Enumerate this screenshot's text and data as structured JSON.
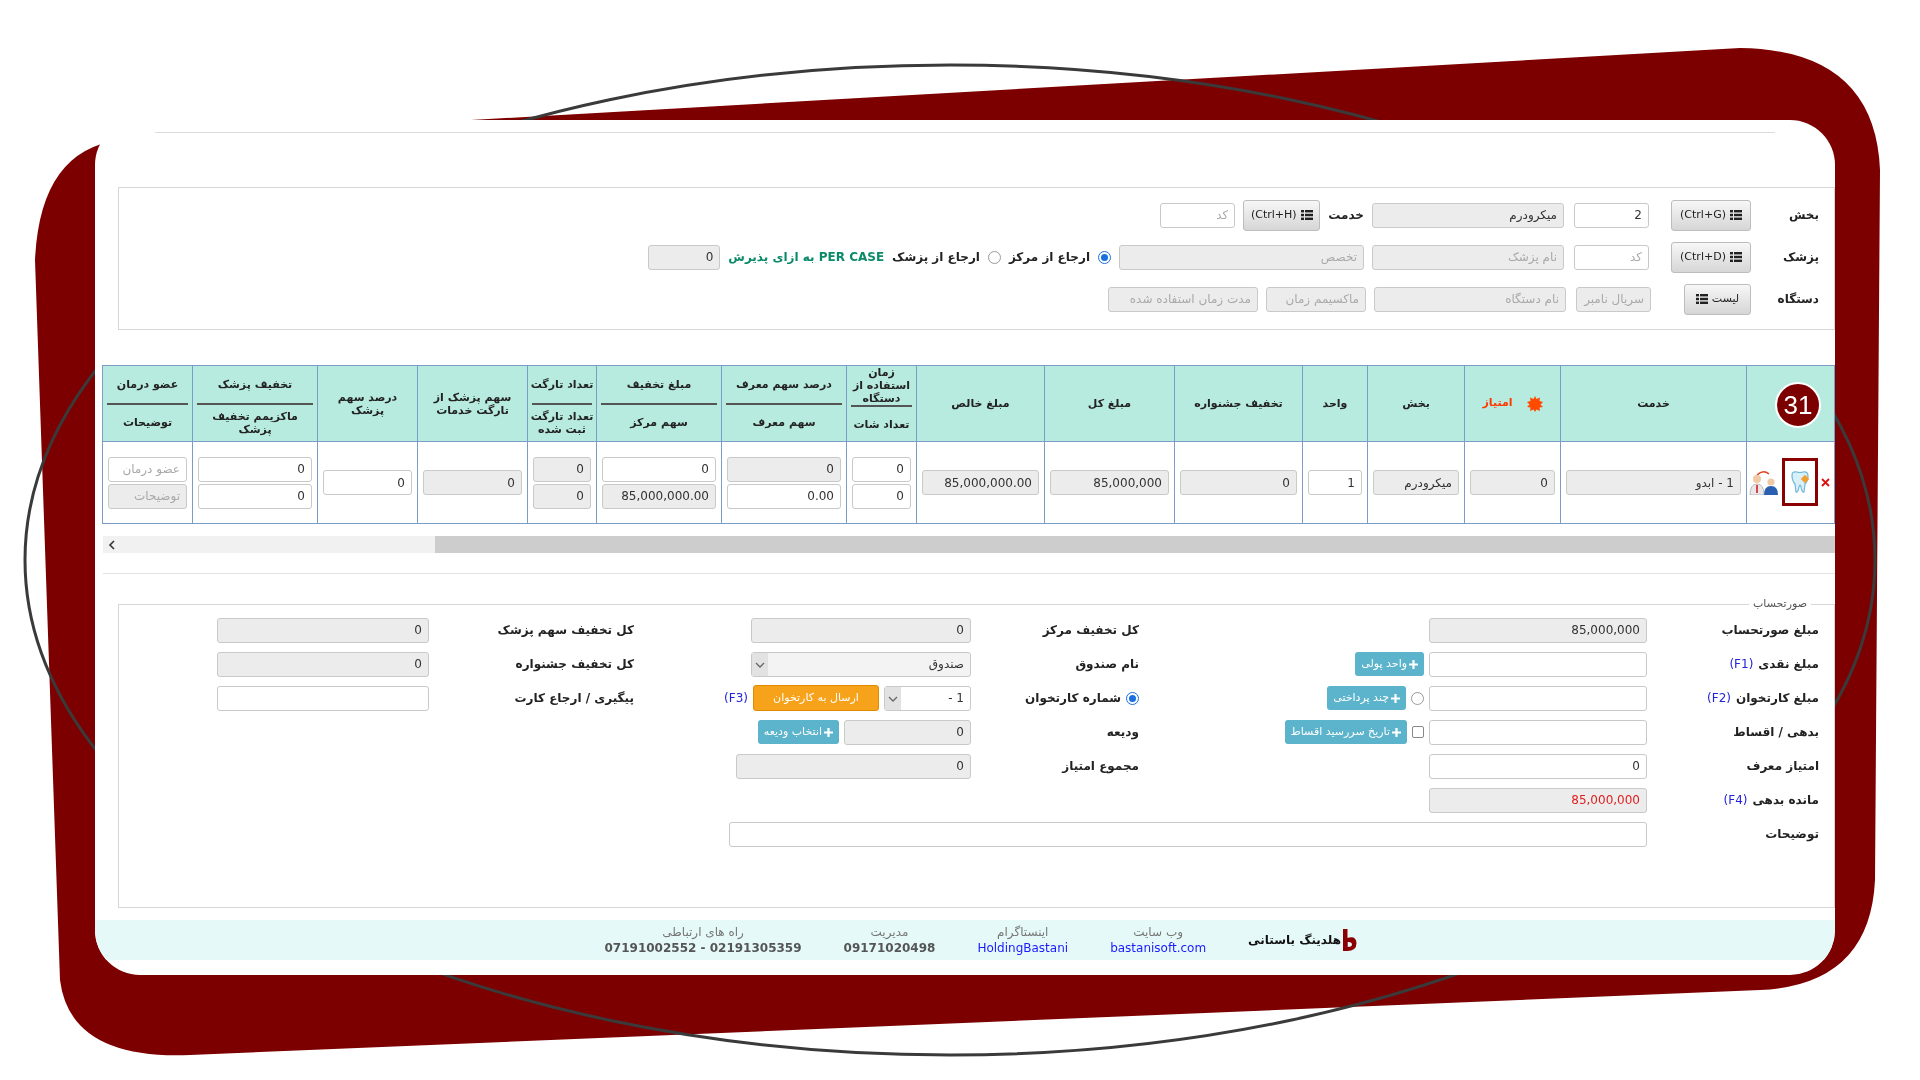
{
  "top_form": {
    "section": {
      "label": "بخش",
      "button": "(Ctrl+G)",
      "code": {
        "value": "2",
        "readonly": false
      },
      "name": {
        "value": "میکرودرم",
        "readonly": true
      }
    },
    "service": {
      "label": "خدمت",
      "button": "(Ctrl+H)",
      "code": {
        "placeholder": "کد",
        "readonly": false
      }
    },
    "doctor": {
      "label": "پزشک",
      "button": "(Ctrl+D)",
      "code": {
        "placeholder": "کد",
        "readonly": false
      },
      "name": {
        "placeholder": "نام پزشک",
        "readonly": true
      },
      "specialty": {
        "placeholder": "تخصص",
        "readonly": true
      }
    },
    "referral": [
      {
        "label": "ارجاع از مرکز",
        "selected": true
      },
      {
        "label": "ارجاع از پزشک",
        "selected": false
      }
    ],
    "per_case": {
      "label": "PER CASE به ازای پذیرش",
      "field": {
        "value": "0",
        "readonly": true
      }
    },
    "device": {
      "label": "دستگاه",
      "button": "لیست",
      "fields": [
        {
          "placeholder": "سریال نامبر",
          "readonly": true
        },
        {
          "placeholder": "نام دستگاه",
          "readonly": true
        },
        {
          "placeholder": "ماکسیمم زمان",
          "readonly": true
        },
        {
          "placeholder": "مدت زمان استفاده شده",
          "readonly": true
        }
      ]
    }
  },
  "table": {
    "columns": [
      {
        "kind": "actions"
      },
      {
        "kind": "text",
        "label": "خدمت",
        "cells": [
          {
            "value": "1 - ابدو",
            "readonly": true
          }
        ]
      },
      {
        "kind": "score",
        "label": "امتیاز",
        "cells": [
          {
            "value": "0",
            "readonly": true
          }
        ]
      },
      {
        "kind": "text",
        "label": "بخش",
        "cells": [
          {
            "value": "میکرودرم",
            "readonly": true
          }
        ]
      },
      {
        "kind": "text",
        "label": "واحد",
        "cells": [
          {
            "value": "1",
            "readonly": false
          }
        ]
      },
      {
        "kind": "text",
        "label": "تخفیف جشنواره",
        "cells": [
          {
            "value": "0",
            "readonly": true
          }
        ]
      },
      {
        "kind": "text",
        "label": "مبلغ کل",
        "cells": [
          {
            "value": "85,000,000",
            "readonly": true
          }
        ]
      },
      {
        "kind": "text",
        "label": "مبلغ خالص",
        "cells": [
          {
            "value": "85,000,000.00",
            "readonly": true
          }
        ]
      },
      {
        "kind": "double",
        "top": "زمان استفاده از دستگاه",
        "bottom": "تعداد شات",
        "cells": [
          {
            "value": "0",
            "readonly": false
          },
          {
            "value": "0",
            "readonly": false
          }
        ]
      },
      {
        "kind": "double",
        "top": "درصد سهم معرف",
        "bottom": "سهم معرف",
        "cells": [
          {
            "value": "0",
            "readonly": true
          },
          {
            "value": "0.00",
            "readonly": false
          }
        ]
      },
      {
        "kind": "double",
        "top": "مبلغ تخفیف",
        "bottom": "سهم مرکز",
        "cells": [
          {
            "value": "0",
            "readonly": false
          },
          {
            "value": "85,000,000.00",
            "readonly": true
          }
        ]
      },
      {
        "kind": "double",
        "top": "تعداد تارگت",
        "bottom": "تعداد تارگت ثبت شده",
        "cells": [
          {
            "value": "0",
            "readonly": true
          },
          {
            "value": "0",
            "readonly": true
          }
        ]
      },
      {
        "kind": "text",
        "label": "سهم پزشک از تارگت خدمات",
        "cells": [
          {
            "value": "0",
            "readonly": true
          }
        ]
      },
      {
        "kind": "text",
        "label": "درصد سهم پزشک",
        "cells": [
          {
            "value": "0",
            "readonly": false
          }
        ]
      },
      {
        "kind": "double",
        "top": "تخفیف پزشک",
        "bottom": "ماکزیمم تخفیف پزشک",
        "cells": [
          {
            "value": "0",
            "readonly": false
          },
          {
            "value": "0",
            "readonly": false
          }
        ]
      },
      {
        "kind": "double",
        "top": "عضو درمان",
        "bottom": "توضیحات",
        "cells": [
          {
            "placeholder": "عضو درمان",
            "readonly": false
          },
          {
            "placeholder": "توضیحات",
            "readonly": true
          }
        ]
      }
    ]
  },
  "annotation": {
    "step": "31"
  },
  "invoice": {
    "title": "صورتحساب",
    "rows": [
      {
        "right": {
          "label": "مبلغ صورتحساب",
          "items": [
            {
              "kind": "input",
              "value": "85,000,000",
              "readonly": true
            }
          ]
        },
        "middle": {
          "label": "کل تخفیف مرکز",
          "items": [
            {
              "kind": "input",
              "value": "0",
              "readonly": true
            }
          ]
        },
        "left": {
          "label": "کل تخفیف سهم پزشک",
          "items": [
            {
              "kind": "input",
              "value": "0",
              "readonly": true
            }
          ]
        }
      },
      {
        "right": {
          "label": "مبلغ نقدی",
          "hotkey": "(F1)",
          "items": [
            {
              "kind": "input",
              "readonly": false
            },
            {
              "kind": "button",
              "label": "واحد پولی"
            }
          ]
        },
        "middle": {
          "label": "نام صندوق",
          "items": [
            {
              "kind": "select",
              "value": "صندوق",
              "readonly": true
            }
          ]
        },
        "left": {
          "label": "کل تخفیف جشنواره",
          "items": [
            {
              "kind": "input",
              "value": "0",
              "readonly": true
            }
          ]
        }
      },
      {
        "right": {
          "label": "مبلغ کارتخوان",
          "hotkey": "(F2)",
          "items": [
            {
              "kind": "input",
              "readonly": false
            },
            {
              "kind": "radio",
              "selected": false
            },
            {
              "kind": "button",
              "label": "چند پرداختی"
            }
          ]
        },
        "middle": {
          "label_radio": {
            "selected": true
          },
          "label": "شماره کارتخوان",
          "items": [
            {
              "kind": "select",
              "value": "1 -",
              "readonly": false
            },
            {
              "kind": "send_button",
              "label": "ارسال به کارتخوان"
            },
            {
              "kind": "hotkey",
              "text": "(F3)"
            }
          ]
        },
        "left": {
          "label": "پیگیری / ارجاع کارت",
          "items": [
            {
              "kind": "input",
              "readonly": false
            }
          ]
        }
      },
      {
        "right": {
          "label": "بدهی / اقساط",
          "items": [
            {
              "kind": "input",
              "readonly": false
            },
            {
              "kind": "checkbox",
              "checked": false
            },
            {
              "kind": "button",
              "label": "تاریخ سررسید اقساط"
            }
          ]
        },
        "middle": {
          "label": "ودیعه",
          "items": [
            {
              "kind": "input",
              "value": "0",
              "readonly": true
            },
            {
              "kind": "button",
              "label": "انتخاب ودیعه"
            }
          ]
        }
      },
      {
        "right": {
          "label": "امتیاز معرف",
          "items": [
            {
              "kind": "input",
              "value": "0",
              "readonly": false
            }
          ]
        },
        "middle": {
          "label": "مجموع امتیاز",
          "items": [
            {
              "kind": "input",
              "value": "0",
              "readonly": true
            }
          ]
        }
      },
      {
        "right": {
          "label": "مانده بدهی",
          "hotkey": "(F4)",
          "items": [
            {
              "kind": "input",
              "value": "85,000,000",
              "readonly": true,
              "warning": true
            }
          ]
        }
      },
      {
        "right": {
          "label": "توضیحات",
          "items": [
            {
              "kind": "input",
              "readonly": false
            }
          ]
        }
      }
    ]
  },
  "footer": {
    "company": "هلدینگ باستانی",
    "items": [
      {
        "label": "وب سایت",
        "value": "bastanisoft.com",
        "link": true
      },
      {
        "label": "اینستاگرام",
        "value": "HoldingBastani",
        "link": true
      },
      {
        "label": "مدیریت",
        "value": "09171020498",
        "link": false
      },
      {
        "label": "راه های ارتباطی",
        "value": "07191002552 - 02191305359",
        "link": false
      }
    ]
  }
}
